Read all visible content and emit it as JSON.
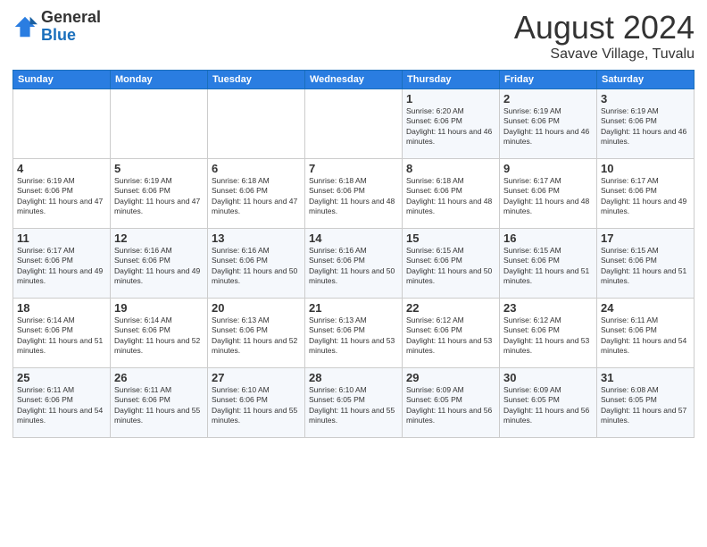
{
  "header": {
    "logo_general": "General",
    "logo_blue": "Blue",
    "month_year": "August 2024",
    "location": "Savave Village, Tuvalu"
  },
  "weekdays": [
    "Sunday",
    "Monday",
    "Tuesday",
    "Wednesday",
    "Thursday",
    "Friday",
    "Saturday"
  ],
  "weeks": [
    [
      {
        "day": "",
        "sunrise": "",
        "sunset": "",
        "daylight": ""
      },
      {
        "day": "",
        "sunrise": "",
        "sunset": "",
        "daylight": ""
      },
      {
        "day": "",
        "sunrise": "",
        "sunset": "",
        "daylight": ""
      },
      {
        "day": "",
        "sunrise": "",
        "sunset": "",
        "daylight": ""
      },
      {
        "day": "1",
        "sunrise": "Sunrise: 6:20 AM",
        "sunset": "Sunset: 6:06 PM",
        "daylight": "Daylight: 11 hours and 46 minutes."
      },
      {
        "day": "2",
        "sunrise": "Sunrise: 6:19 AM",
        "sunset": "Sunset: 6:06 PM",
        "daylight": "Daylight: 11 hours and 46 minutes."
      },
      {
        "day": "3",
        "sunrise": "Sunrise: 6:19 AM",
        "sunset": "Sunset: 6:06 PM",
        "daylight": "Daylight: 11 hours and 46 minutes."
      }
    ],
    [
      {
        "day": "4",
        "sunrise": "Sunrise: 6:19 AM",
        "sunset": "Sunset: 6:06 PM",
        "daylight": "Daylight: 11 hours and 47 minutes."
      },
      {
        "day": "5",
        "sunrise": "Sunrise: 6:19 AM",
        "sunset": "Sunset: 6:06 PM",
        "daylight": "Daylight: 11 hours and 47 minutes."
      },
      {
        "day": "6",
        "sunrise": "Sunrise: 6:18 AM",
        "sunset": "Sunset: 6:06 PM",
        "daylight": "Daylight: 11 hours and 47 minutes."
      },
      {
        "day": "7",
        "sunrise": "Sunrise: 6:18 AM",
        "sunset": "Sunset: 6:06 PM",
        "daylight": "Daylight: 11 hours and 48 minutes."
      },
      {
        "day": "8",
        "sunrise": "Sunrise: 6:18 AM",
        "sunset": "Sunset: 6:06 PM",
        "daylight": "Daylight: 11 hours and 48 minutes."
      },
      {
        "day": "9",
        "sunrise": "Sunrise: 6:17 AM",
        "sunset": "Sunset: 6:06 PM",
        "daylight": "Daylight: 11 hours and 48 minutes."
      },
      {
        "day": "10",
        "sunrise": "Sunrise: 6:17 AM",
        "sunset": "Sunset: 6:06 PM",
        "daylight": "Daylight: 11 hours and 49 minutes."
      }
    ],
    [
      {
        "day": "11",
        "sunrise": "Sunrise: 6:17 AM",
        "sunset": "Sunset: 6:06 PM",
        "daylight": "Daylight: 11 hours and 49 minutes."
      },
      {
        "day": "12",
        "sunrise": "Sunrise: 6:16 AM",
        "sunset": "Sunset: 6:06 PM",
        "daylight": "Daylight: 11 hours and 49 minutes."
      },
      {
        "day": "13",
        "sunrise": "Sunrise: 6:16 AM",
        "sunset": "Sunset: 6:06 PM",
        "daylight": "Daylight: 11 hours and 50 minutes."
      },
      {
        "day": "14",
        "sunrise": "Sunrise: 6:16 AM",
        "sunset": "Sunset: 6:06 PM",
        "daylight": "Daylight: 11 hours and 50 minutes."
      },
      {
        "day": "15",
        "sunrise": "Sunrise: 6:15 AM",
        "sunset": "Sunset: 6:06 PM",
        "daylight": "Daylight: 11 hours and 50 minutes."
      },
      {
        "day": "16",
        "sunrise": "Sunrise: 6:15 AM",
        "sunset": "Sunset: 6:06 PM",
        "daylight": "Daylight: 11 hours and 51 minutes."
      },
      {
        "day": "17",
        "sunrise": "Sunrise: 6:15 AM",
        "sunset": "Sunset: 6:06 PM",
        "daylight": "Daylight: 11 hours and 51 minutes."
      }
    ],
    [
      {
        "day": "18",
        "sunrise": "Sunrise: 6:14 AM",
        "sunset": "Sunset: 6:06 PM",
        "daylight": "Daylight: 11 hours and 51 minutes."
      },
      {
        "day": "19",
        "sunrise": "Sunrise: 6:14 AM",
        "sunset": "Sunset: 6:06 PM",
        "daylight": "Daylight: 11 hours and 52 minutes."
      },
      {
        "day": "20",
        "sunrise": "Sunrise: 6:13 AM",
        "sunset": "Sunset: 6:06 PM",
        "daylight": "Daylight: 11 hours and 52 minutes."
      },
      {
        "day": "21",
        "sunrise": "Sunrise: 6:13 AM",
        "sunset": "Sunset: 6:06 PM",
        "daylight": "Daylight: 11 hours and 53 minutes."
      },
      {
        "day": "22",
        "sunrise": "Sunrise: 6:12 AM",
        "sunset": "Sunset: 6:06 PM",
        "daylight": "Daylight: 11 hours and 53 minutes."
      },
      {
        "day": "23",
        "sunrise": "Sunrise: 6:12 AM",
        "sunset": "Sunset: 6:06 PM",
        "daylight": "Daylight: 11 hours and 53 minutes."
      },
      {
        "day": "24",
        "sunrise": "Sunrise: 6:11 AM",
        "sunset": "Sunset: 6:06 PM",
        "daylight": "Daylight: 11 hours and 54 minutes."
      }
    ],
    [
      {
        "day": "25",
        "sunrise": "Sunrise: 6:11 AM",
        "sunset": "Sunset: 6:06 PM",
        "daylight": "Daylight: 11 hours and 54 minutes."
      },
      {
        "day": "26",
        "sunrise": "Sunrise: 6:11 AM",
        "sunset": "Sunset: 6:06 PM",
        "daylight": "Daylight: 11 hours and 55 minutes."
      },
      {
        "day": "27",
        "sunrise": "Sunrise: 6:10 AM",
        "sunset": "Sunset: 6:06 PM",
        "daylight": "Daylight: 11 hours and 55 minutes."
      },
      {
        "day": "28",
        "sunrise": "Sunrise: 6:10 AM",
        "sunset": "Sunset: 6:05 PM",
        "daylight": "Daylight: 11 hours and 55 minutes."
      },
      {
        "day": "29",
        "sunrise": "Sunrise: 6:09 AM",
        "sunset": "Sunset: 6:05 PM",
        "daylight": "Daylight: 11 hours and 56 minutes."
      },
      {
        "day": "30",
        "sunrise": "Sunrise: 6:09 AM",
        "sunset": "Sunset: 6:05 PM",
        "daylight": "Daylight: 11 hours and 56 minutes."
      },
      {
        "day": "31",
        "sunrise": "Sunrise: 6:08 AM",
        "sunset": "Sunset: 6:05 PM",
        "daylight": "Daylight: 11 hours and 57 minutes."
      }
    ]
  ]
}
